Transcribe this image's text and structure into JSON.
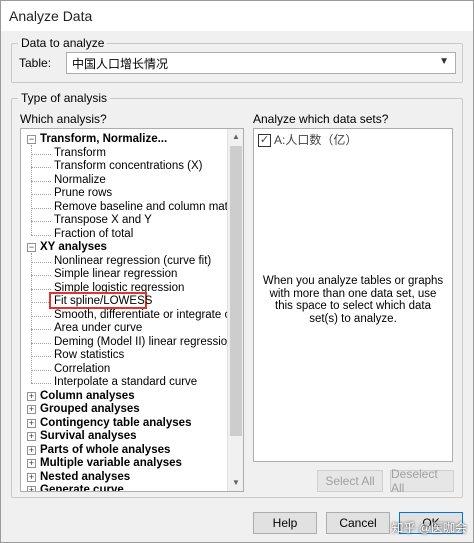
{
  "window": {
    "title": "Analyze Data"
  },
  "data_group": {
    "caption": "Data to analyze",
    "table_label": "Table:",
    "table_value": "中国人口增长情况"
  },
  "type_group": {
    "caption": "Type of analysis",
    "which_analysis_label": "Which analysis?",
    "which_datasets_label": "Analyze which data sets?"
  },
  "tree": [
    {
      "kind": "group",
      "expanded": true,
      "label": "Transform, Normalize..."
    },
    {
      "kind": "item",
      "label": "Transform"
    },
    {
      "kind": "item",
      "label": "Transform concentrations (X)"
    },
    {
      "kind": "item",
      "label": "Normalize"
    },
    {
      "kind": "item",
      "label": "Prune rows"
    },
    {
      "kind": "item",
      "label": "Remove baseline and column math"
    },
    {
      "kind": "item",
      "label": "Transpose X and Y"
    },
    {
      "kind": "item",
      "label": "Fraction of total"
    },
    {
      "kind": "group",
      "expanded": true,
      "label": "XY analyses"
    },
    {
      "kind": "item",
      "label": "Nonlinear regression (curve fit)"
    },
    {
      "kind": "item",
      "label": "Simple linear regression"
    },
    {
      "kind": "item",
      "label": "Simple logistic regression"
    },
    {
      "kind": "item",
      "label": "Fit spline/LOWESS",
      "highlighted": true
    },
    {
      "kind": "item",
      "label": "Smooth, differentiate or integrate curve"
    },
    {
      "kind": "item",
      "label": "Area under curve"
    },
    {
      "kind": "item",
      "label": "Deming (Model II) linear regression"
    },
    {
      "kind": "item",
      "label": "Row statistics"
    },
    {
      "kind": "item",
      "label": "Correlation"
    },
    {
      "kind": "item",
      "label": "Interpolate a standard curve"
    },
    {
      "kind": "group",
      "expanded": false,
      "label": "Column analyses"
    },
    {
      "kind": "group",
      "expanded": false,
      "label": "Grouped analyses"
    },
    {
      "kind": "group",
      "expanded": false,
      "label": "Contingency table analyses"
    },
    {
      "kind": "group",
      "expanded": false,
      "label": "Survival analyses"
    },
    {
      "kind": "group",
      "expanded": false,
      "label": "Parts of whole analyses"
    },
    {
      "kind": "group",
      "expanded": false,
      "label": "Multiple variable analyses"
    },
    {
      "kind": "group",
      "expanded": false,
      "label": "Nested analyses"
    },
    {
      "kind": "group",
      "expanded": false,
      "label": "Generate curve"
    }
  ],
  "datasets": [
    {
      "label": "A:人口数（亿）",
      "checked": true
    }
  ],
  "datasets_hint": "When you analyze tables or graphs with more than one data set, use this space to select which data set(s) to analyze.",
  "buttons": {
    "select_all": "Select All",
    "deselect_all": "Deselect All",
    "help": "Help",
    "cancel": "Cancel",
    "ok": "OK"
  },
  "watermark": "知乎 @医咖会",
  "icons": {
    "combo_arrow": "chevron-down-icon",
    "expand": "plus-box-icon",
    "collapse": "minus-box-icon",
    "check": "checkmark-icon"
  },
  "colors": {
    "highlight_border": "#e0342c",
    "primary_button_border": "#0078d7"
  }
}
